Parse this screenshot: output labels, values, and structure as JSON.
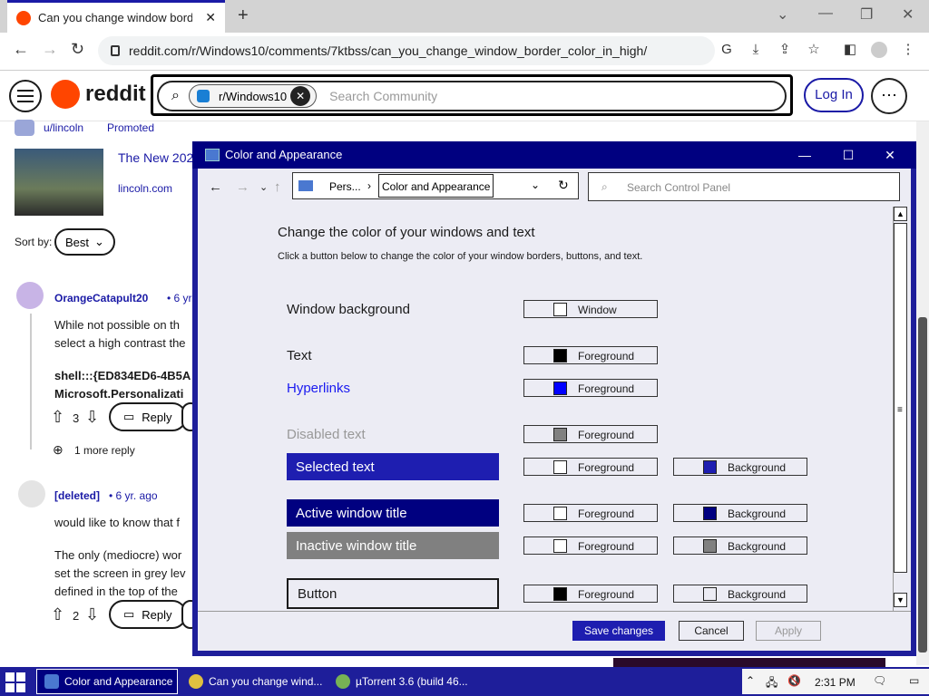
{
  "browser": {
    "tab_title": "Can you change window border c",
    "url": "reddit.com/r/Windows10/comments/7ktbss/can_you_change_window_border_color_in_high/",
    "new_tab": "+",
    "win_min": "—",
    "win_restore": "❐",
    "win_close": "✕"
  },
  "reddit": {
    "logo_text": "reddit",
    "subreddit_chip": "r/Windows10",
    "search_placeholder": "Search Community",
    "login": "Log In",
    "ad_user": "u/lincoln",
    "ad_promoted": "Promoted",
    "ad_title": "The New 202",
    "ad_domain": "lincoln.com",
    "sort_label": "Sort by:",
    "sort_value": "Best",
    "comment1_user": "OrangeCatapult20",
    "comment1_age": "• 6 yr.",
    "comment1_line1": "While not possible on th",
    "comment1_line2": "select a high contrast the",
    "comment1_code1": "shell:::{ED834ED6-4B5A",
    "comment1_code2": "Microsoft.Personalizati",
    "comment1_votes": "3",
    "reply_label": "Reply",
    "more_replies": "1 more reply",
    "comment2_user": "[deleted]",
    "comment2_age": "• 6 yr. ago",
    "comment2_line1": "would like to know that f",
    "comment2_line2": "The only (mediocre) wor",
    "comment2_line3": "set the screen in grey lev",
    "comment2_line4": "defined in the top of the",
    "comment2_votes": "2"
  },
  "dialog": {
    "title": "Color and Appearance",
    "breadcrumb_parent": "Pers...",
    "breadcrumb_current": "Color and Appearance",
    "search_placeholder": "Search Control Panel",
    "heading": "Change the color of your windows and text",
    "subheading": "Click a button below to change the color of your window borders, buttons, and text.",
    "rows": [
      {
        "label": "Window background",
        "fg_label": "Window",
        "fg_color": "#ffffff"
      },
      {
        "label": "Text",
        "fg_label": "Foreground",
        "fg_color": "#000000"
      },
      {
        "label": "Hyperlinks",
        "fg_label": "Foreground",
        "fg_color": "#0000ff"
      },
      {
        "label": "Disabled text",
        "fg_label": "Foreground",
        "fg_color": "#808080"
      },
      {
        "label": "Selected text",
        "fg_label": "Foreground",
        "fg_color": "#ffffff",
        "bg_label": "Background",
        "bg_color": "#1e1eb0"
      },
      {
        "label": "Active window title",
        "fg_label": "Foreground",
        "fg_color": "#ffffff",
        "bg_label": "Background",
        "bg_color": "#000080"
      },
      {
        "label": "Inactive window title",
        "fg_label": "Foreground",
        "fg_color": "#ffffff",
        "bg_label": "Background",
        "bg_color": "#808080"
      },
      {
        "label": "Button",
        "fg_label": "Foreground",
        "fg_color": "#000000",
        "bg_label": "Background",
        "bg_color": "#ececf4"
      }
    ],
    "save": "Save changes",
    "cancel": "Cancel",
    "apply": "Apply"
  },
  "taskbar": {
    "item1": "Color and Appearance",
    "item2": "Can you change wind...",
    "item3": "µTorrent 3.6  (build 46...",
    "time": "2:31 PM"
  },
  "colors": {
    "accent": "#1e1e9a",
    "title_active": "#000080",
    "link": "#1a1aa6",
    "reddit_orange": "#ff4500"
  }
}
